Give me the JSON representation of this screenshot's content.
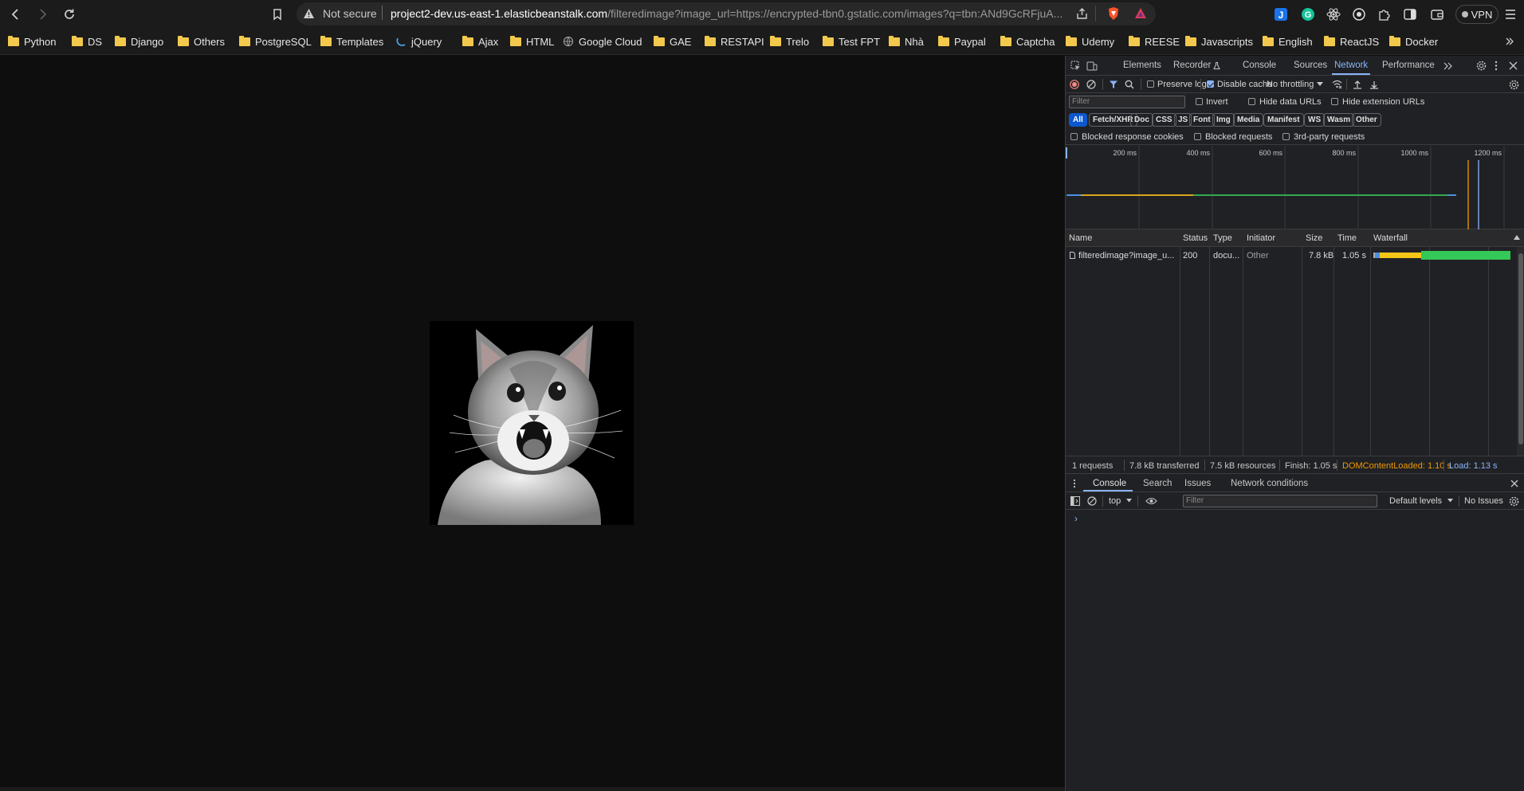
{
  "browser": {
    "security_label": "Not secure",
    "url_host": "project2-dev.us-east-1.elasticbeanstalk.com",
    "url_rest": "/filteredimage?image_url=https://encrypted-tbn0.gstatic.com/images?q=tbn:ANd9GcRFjuA...",
    "vpn_label": "VPN"
  },
  "bookmarks": [
    {
      "label": "Python",
      "icon": "folder-icon"
    },
    {
      "label": "DS",
      "icon": "folder-icon"
    },
    {
      "label": "Django",
      "icon": "folder-icon"
    },
    {
      "label": "Others",
      "icon": "folder-icon"
    },
    {
      "label": "PostgreSQL",
      "icon": "folder-icon"
    },
    {
      "label": "Templates",
      "icon": "folder-icon"
    },
    {
      "label": "jQuery",
      "icon": "jquery-icon"
    },
    {
      "label": "Ajax",
      "icon": "folder-icon"
    },
    {
      "label": "HTML",
      "icon": "folder-icon"
    },
    {
      "label": "Google Cloud",
      "icon": "globe-icon"
    },
    {
      "label": "GAE",
      "icon": "folder-icon"
    },
    {
      "label": "RESTAPI",
      "icon": "folder-icon"
    },
    {
      "label": "Trelo",
      "icon": "folder-icon"
    },
    {
      "label": "Test FPT",
      "icon": "folder-icon"
    },
    {
      "label": "Nhà",
      "icon": "folder-icon"
    },
    {
      "label": "Paypal",
      "icon": "folder-icon"
    },
    {
      "label": "Captcha",
      "icon": "folder-icon"
    },
    {
      "label": "Udemy",
      "icon": "folder-icon"
    },
    {
      "label": "REESE",
      "icon": "folder-icon"
    },
    {
      "label": "Javascripts",
      "icon": "folder-icon"
    },
    {
      "label": "English",
      "icon": "folder-icon"
    },
    {
      "label": "ReactJS",
      "icon": "folder-icon"
    },
    {
      "label": "Docker",
      "icon": "folder-icon"
    }
  ],
  "devtools": {
    "tabs": [
      "Elements",
      "Recorder",
      "Console",
      "Sources",
      "Network",
      "Performance"
    ],
    "active_tab": "Network",
    "actions": {
      "preserve_log": "Preserve log",
      "preserve_log_checked": false,
      "disable_cache": "Disable cache",
      "disable_cache_checked": true,
      "throttling": "No throttling"
    },
    "filter_placeholder": "Filter",
    "invert_label": "Invert",
    "hide_data_urls": "Hide data URLs",
    "hide_extension_urls": "Hide extension URLs",
    "type_filters": [
      "All",
      "Fetch/XHR",
      "Doc",
      "CSS",
      "JS",
      "Font",
      "Img",
      "Media",
      "Manifest",
      "WS",
      "Wasm",
      "Other"
    ],
    "active_type": "All",
    "blocked_response_cookies": "Blocked response cookies",
    "blocked_requests": "Blocked requests",
    "third_party_requests": "3rd-party requests",
    "overview_ticks": [
      "200 ms",
      "400 ms",
      "600 ms",
      "800 ms",
      "1000 ms",
      "1200 ms"
    ],
    "columns": [
      "Name",
      "Status",
      "Type",
      "Initiator",
      "Size",
      "Time",
      "Waterfall"
    ],
    "requests": [
      {
        "name": "filteredimage?image_u...",
        "status": "200",
        "type": "docu...",
        "initiator": "Other",
        "size": "7.8 kB",
        "time": "1.05 s"
      }
    ],
    "summary": {
      "requests": "1 requests",
      "transferred": "7.8 kB transferred",
      "resources": "7.5 kB resources",
      "finish": "Finish: 1.05 s",
      "dom_content_loaded": "DOMContentLoaded: 1.10 s",
      "load": "Load: 1.13 s"
    },
    "drawer_tabs": [
      "Console",
      "Search",
      "Issues",
      "Network conditions"
    ],
    "drawer_active": "Console",
    "console": {
      "context": "top",
      "filter_placeholder": "Filter",
      "levels": "Default levels",
      "issues": "No Issues",
      "prompt": "›"
    },
    "colors": {
      "accent": "#8ab4f8",
      "dcl": "#f29900",
      "load": "#8ab4f8",
      "waiting": "#f5c518",
      "download": "#34c759"
    }
  }
}
